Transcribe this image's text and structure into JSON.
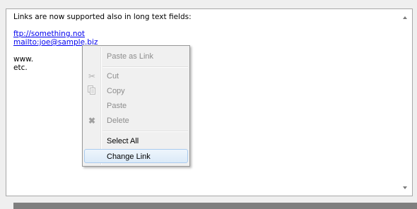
{
  "editor": {
    "lines": [
      "Links are now supported also in long text fields:",
      "",
      "ftp://something.not",
      "mailto:joe@sample.biz",
      "",
      "www.",
      "etc."
    ]
  },
  "context_menu": {
    "paste_as_link": "Paste as Link",
    "cut": "Cut",
    "copy": "Copy",
    "paste": "Paste",
    "delete": "Delete",
    "select_all": "Select All",
    "change_link": "Change Link"
  },
  "icons": {
    "cut": "scissors-icon",
    "copy": "copy-icon",
    "delete": "delete-x-icon"
  }
}
